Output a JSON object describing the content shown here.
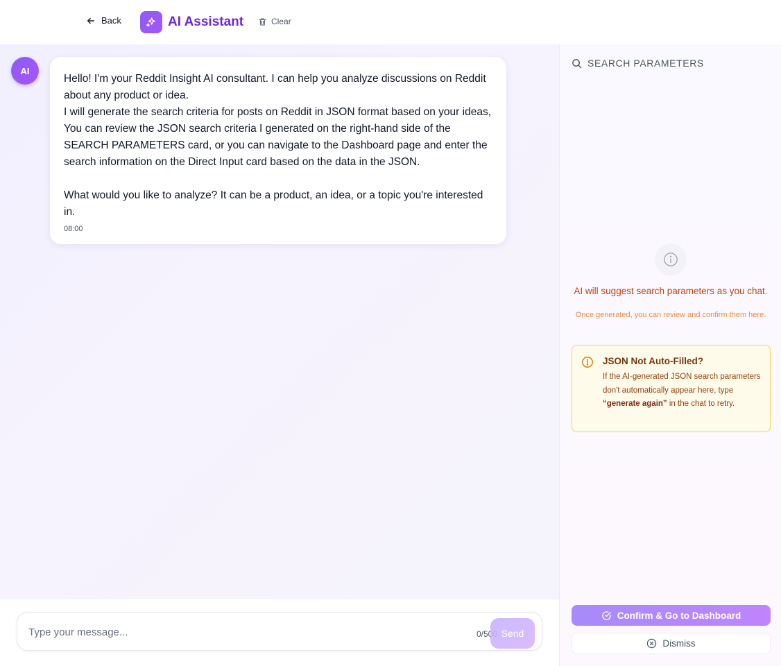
{
  "header": {
    "back_label": "Back",
    "title": "AI Assistant",
    "clear_label": "Clear"
  },
  "chat": {
    "avatar_label": "AI",
    "message": {
      "line1": "Hello! I'm your Reddit Insight AI consultant. I can help you analyze discussions on Reddit about any product or idea.",
      "line2": "I will generate the search criteria for posts on Reddit in JSON format based on your ideas, You can review the JSON search criteria I generated on the right-hand side of the SEARCH PARAMETERS card, or you can navigate to the Dashboard page and enter the search information on the Direct Input card based on the data in the JSON.",
      "line3": "What would you like to analyze? It can be a product, an idea, or a topic you're interested in.",
      "time": "08:00"
    }
  },
  "composer": {
    "placeholder": "Type your message...",
    "counter": "0/500",
    "send_label": "Send"
  },
  "panel": {
    "heading": "SEARCH PARAMETERS",
    "hint_main": "AI will suggest search parameters as you chat.",
    "hint_sub": "Once generated, you can review and confirm them here.",
    "warning": {
      "title": "JSON Not Auto-Filled?",
      "text_before": "If the AI-generated JSON search parameters don't automatically appear here, type ",
      "text_bold": "“generate again”",
      "text_after": " in the chat to retry."
    },
    "confirm_label": "Confirm & Go to Dashboard",
    "dismiss_label": "Dismiss"
  },
  "colors": {
    "accent": "#7c3aed",
    "warning_border": "#fcd34d",
    "warning_bg": "#fffbeb",
    "hint": "#c2410c"
  }
}
